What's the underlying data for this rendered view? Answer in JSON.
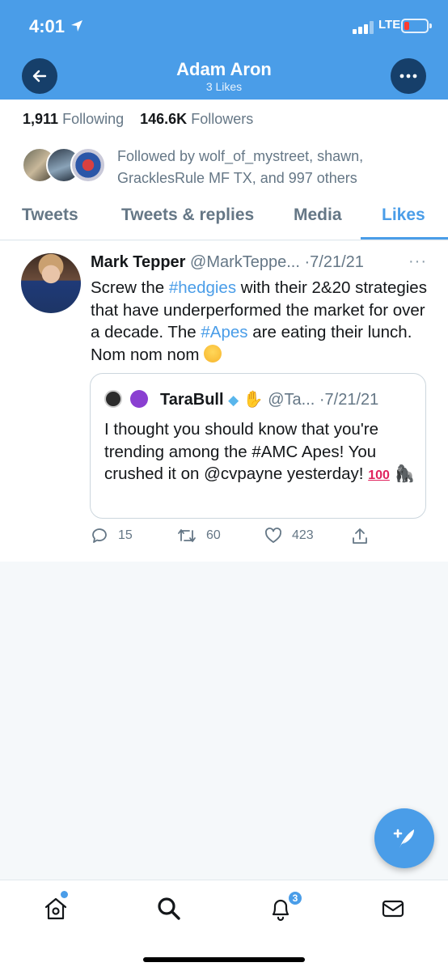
{
  "status_bar": {
    "time": "4:01",
    "network": "LTE"
  },
  "header": {
    "title": "Adam Aron",
    "subtitle": "3 Likes"
  },
  "profile": {
    "following_count": "1,911",
    "following_label": "Following",
    "followers_count": "146.6K",
    "followers_label": "Followers",
    "followed_by": "Followed by wolf_of_mystreet, shawn, GracklesRule MF TX, and 997 others"
  },
  "tabs": [
    {
      "label": "Tweets"
    },
    {
      "label": "Tweets & replies"
    },
    {
      "label": "Media"
    },
    {
      "label": "Likes",
      "active": true
    }
  ],
  "tweet": {
    "author_name": "Mark Tepper",
    "author_handle": "@MarkTeppe...",
    "date": "·7/21/21",
    "more": "···",
    "text_parts": [
      "Screw the ",
      "#hedgies",
      " with their 2&20 strategies that have underperformed the market for over a decade. The ",
      "#Apes",
      " are eating their lunch. Nom nom nom "
    ],
    "quote": {
      "author_name": "TaraBull",
      "author_handle": "@Ta...",
      "date": "·7/21/21",
      "text": "I thought you should know that you're trending among the #AMC Apes! You crushed it on @cvpayne yesterday! ",
      "hundred": "100"
    },
    "replies": "15",
    "retweets": "60",
    "likes": "423"
  },
  "icons": {
    "back": "arrow-left-icon",
    "more": "ellipsis-icon",
    "reply": "comment-icon",
    "retweet": "retweet-icon",
    "like": "heart-icon",
    "share": "share-icon",
    "compose": "compose-icon",
    "home": "home-icon",
    "search": "search-icon",
    "notifications": "bell-icon",
    "messages": "mail-icon"
  },
  "bottom_nav": {
    "notif_badge": "3"
  },
  "colors": {
    "accent": "#4a9de8",
    "header_button": "#163f6a",
    "muted": "#657786"
  }
}
